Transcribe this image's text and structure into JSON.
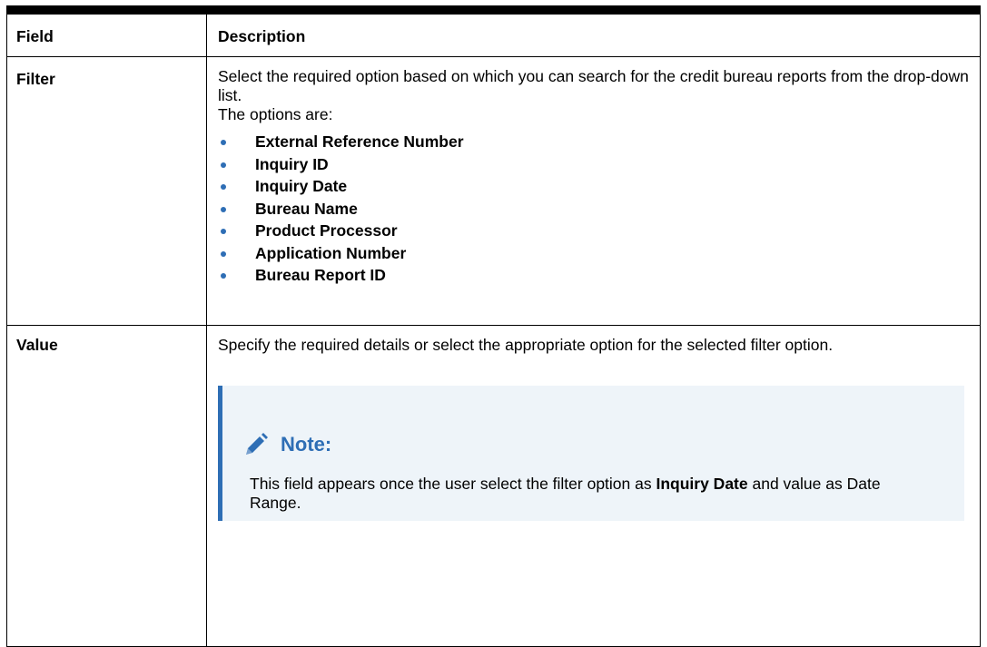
{
  "table": {
    "headers": {
      "field": "Field",
      "description": "Description"
    },
    "rows": [
      {
        "field": "Filter",
        "description_line1": "Select the required option based on which you can search for the credit bureau reports from the drop-down list.",
        "description_line2": "The options are:",
        "options": [
          "External Reference Number",
          "Inquiry ID",
          "Inquiry Date",
          "Bureau Name",
          "Product Processor",
          "Application Number",
          "Bureau Report ID"
        ]
      },
      {
        "field": "Value",
        "description_line1": "Specify the required details or select the appropriate option for the selected filter option.",
        "note": {
          "title": "Note:",
          "text_part1": "This field appears once the user select the filter option as ",
          "text_bold": "Inquiry Date",
          "text_part2": " and value as Date Range."
        }
      }
    ]
  },
  "colors": {
    "accent": "#2e6eb5",
    "note_background": "#eef4f9",
    "rule": "#000000"
  },
  "icons": {
    "note_icon": "pencil-icon"
  }
}
